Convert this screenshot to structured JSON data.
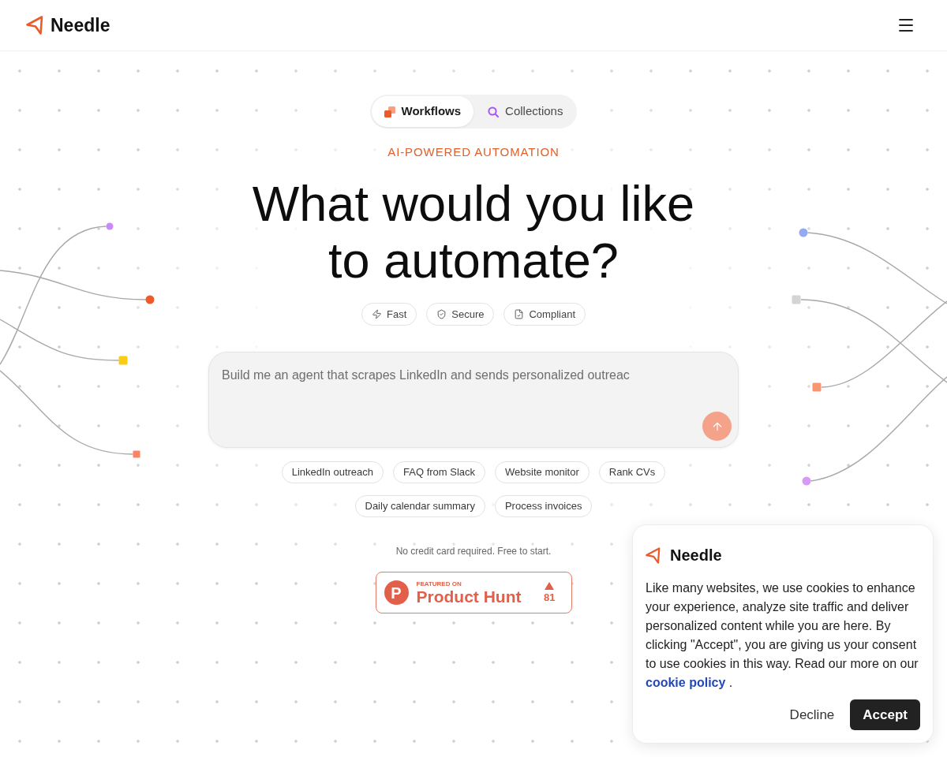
{
  "header": {
    "brand": "Needle"
  },
  "tabs": [
    {
      "label": "Workflows",
      "selected": true
    },
    {
      "label": "Collections",
      "selected": false
    }
  ],
  "eyebrow": "AI-POWERED AUTOMATION",
  "headline": "What would you like to automate?",
  "features": [
    "Fast",
    "Secure",
    "Compliant"
  ],
  "prompt": {
    "placeholder": "Build me an agent that scrapes LinkedIn and sends personalized outreac",
    "send_disabled": true
  },
  "suggestion_rows": [
    [
      "LinkedIn outreach",
      "FAQ from Slack",
      "Website monitor",
      "Rank CVs"
    ],
    [
      "Daily calendar summary",
      "Process invoices"
    ]
  ],
  "note": "No credit card required. Free to start.",
  "product_hunt": {
    "logo_letter": "P",
    "kicker": "FEATURED ON",
    "name": "Product Hunt",
    "votes": "81"
  },
  "cookie_banner": {
    "brand": "Needle",
    "text": "Like many websites, we use cookies to enhance your experience, analyze site traffic and deliver personalized content while you are here. By clicking \"Accept\", you are giving us your consent to use cookies in this way. Read our more on our",
    "link": "cookie policy",
    "text_end": ".",
    "buttons": [
      {
        "label": "Decline",
        "kind": "text"
      },
      {
        "label": "Accept",
        "kind": "primary"
      }
    ]
  }
}
